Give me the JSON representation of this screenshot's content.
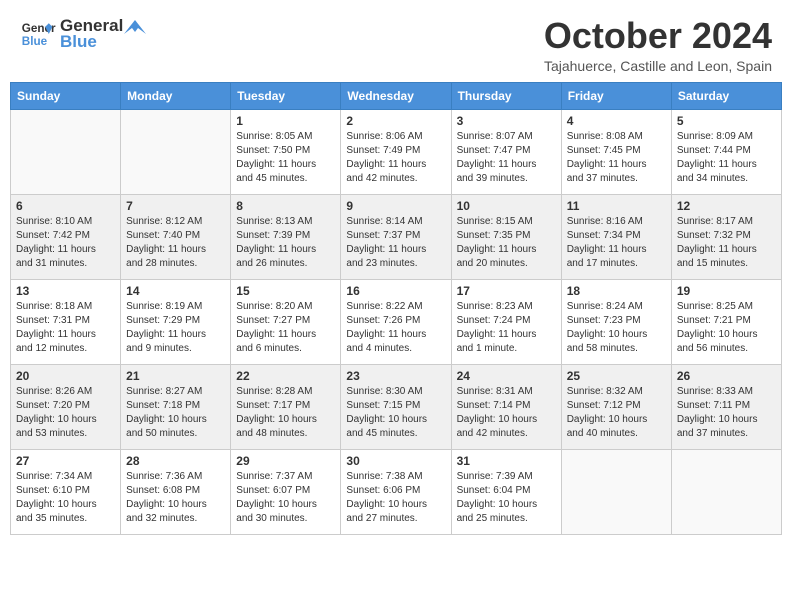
{
  "header": {
    "logo_line1": "General",
    "logo_line2": "Blue",
    "month": "October 2024",
    "location": "Tajahuerce, Castille and Leon, Spain"
  },
  "weekdays": [
    "Sunday",
    "Monday",
    "Tuesday",
    "Wednesday",
    "Thursday",
    "Friday",
    "Saturday"
  ],
  "weeks": [
    [
      {
        "day": "",
        "text": ""
      },
      {
        "day": "",
        "text": ""
      },
      {
        "day": "1",
        "text": "Sunrise: 8:05 AM\nSunset: 7:50 PM\nDaylight: 11 hours and 45 minutes."
      },
      {
        "day": "2",
        "text": "Sunrise: 8:06 AM\nSunset: 7:49 PM\nDaylight: 11 hours and 42 minutes."
      },
      {
        "day": "3",
        "text": "Sunrise: 8:07 AM\nSunset: 7:47 PM\nDaylight: 11 hours and 39 minutes."
      },
      {
        "day": "4",
        "text": "Sunrise: 8:08 AM\nSunset: 7:45 PM\nDaylight: 11 hours and 37 minutes."
      },
      {
        "day": "5",
        "text": "Sunrise: 8:09 AM\nSunset: 7:44 PM\nDaylight: 11 hours and 34 minutes."
      }
    ],
    [
      {
        "day": "6",
        "text": "Sunrise: 8:10 AM\nSunset: 7:42 PM\nDaylight: 11 hours and 31 minutes."
      },
      {
        "day": "7",
        "text": "Sunrise: 8:12 AM\nSunset: 7:40 PM\nDaylight: 11 hours and 28 minutes."
      },
      {
        "day": "8",
        "text": "Sunrise: 8:13 AM\nSunset: 7:39 PM\nDaylight: 11 hours and 26 minutes."
      },
      {
        "day": "9",
        "text": "Sunrise: 8:14 AM\nSunset: 7:37 PM\nDaylight: 11 hours and 23 minutes."
      },
      {
        "day": "10",
        "text": "Sunrise: 8:15 AM\nSunset: 7:35 PM\nDaylight: 11 hours and 20 minutes."
      },
      {
        "day": "11",
        "text": "Sunrise: 8:16 AM\nSunset: 7:34 PM\nDaylight: 11 hours and 17 minutes."
      },
      {
        "day": "12",
        "text": "Sunrise: 8:17 AM\nSunset: 7:32 PM\nDaylight: 11 hours and 15 minutes."
      }
    ],
    [
      {
        "day": "13",
        "text": "Sunrise: 8:18 AM\nSunset: 7:31 PM\nDaylight: 11 hours and 12 minutes."
      },
      {
        "day": "14",
        "text": "Sunrise: 8:19 AM\nSunset: 7:29 PM\nDaylight: 11 hours and 9 minutes."
      },
      {
        "day": "15",
        "text": "Sunrise: 8:20 AM\nSunset: 7:27 PM\nDaylight: 11 hours and 6 minutes."
      },
      {
        "day": "16",
        "text": "Sunrise: 8:22 AM\nSunset: 7:26 PM\nDaylight: 11 hours and 4 minutes."
      },
      {
        "day": "17",
        "text": "Sunrise: 8:23 AM\nSunset: 7:24 PM\nDaylight: 11 hours and 1 minute."
      },
      {
        "day": "18",
        "text": "Sunrise: 8:24 AM\nSunset: 7:23 PM\nDaylight: 10 hours and 58 minutes."
      },
      {
        "day": "19",
        "text": "Sunrise: 8:25 AM\nSunset: 7:21 PM\nDaylight: 10 hours and 56 minutes."
      }
    ],
    [
      {
        "day": "20",
        "text": "Sunrise: 8:26 AM\nSunset: 7:20 PM\nDaylight: 10 hours and 53 minutes."
      },
      {
        "day": "21",
        "text": "Sunrise: 8:27 AM\nSunset: 7:18 PM\nDaylight: 10 hours and 50 minutes."
      },
      {
        "day": "22",
        "text": "Sunrise: 8:28 AM\nSunset: 7:17 PM\nDaylight: 10 hours and 48 minutes."
      },
      {
        "day": "23",
        "text": "Sunrise: 8:30 AM\nSunset: 7:15 PM\nDaylight: 10 hours and 45 minutes."
      },
      {
        "day": "24",
        "text": "Sunrise: 8:31 AM\nSunset: 7:14 PM\nDaylight: 10 hours and 42 minutes."
      },
      {
        "day": "25",
        "text": "Sunrise: 8:32 AM\nSunset: 7:12 PM\nDaylight: 10 hours and 40 minutes."
      },
      {
        "day": "26",
        "text": "Sunrise: 8:33 AM\nSunset: 7:11 PM\nDaylight: 10 hours and 37 minutes."
      }
    ],
    [
      {
        "day": "27",
        "text": "Sunrise: 7:34 AM\nSunset: 6:10 PM\nDaylight: 10 hours and 35 minutes."
      },
      {
        "day": "28",
        "text": "Sunrise: 7:36 AM\nSunset: 6:08 PM\nDaylight: 10 hours and 32 minutes."
      },
      {
        "day": "29",
        "text": "Sunrise: 7:37 AM\nSunset: 6:07 PM\nDaylight: 10 hours and 30 minutes."
      },
      {
        "day": "30",
        "text": "Sunrise: 7:38 AM\nSunset: 6:06 PM\nDaylight: 10 hours and 27 minutes."
      },
      {
        "day": "31",
        "text": "Sunrise: 7:39 AM\nSunset: 6:04 PM\nDaylight: 10 hours and 25 minutes."
      },
      {
        "day": "",
        "text": ""
      },
      {
        "day": "",
        "text": ""
      }
    ]
  ]
}
